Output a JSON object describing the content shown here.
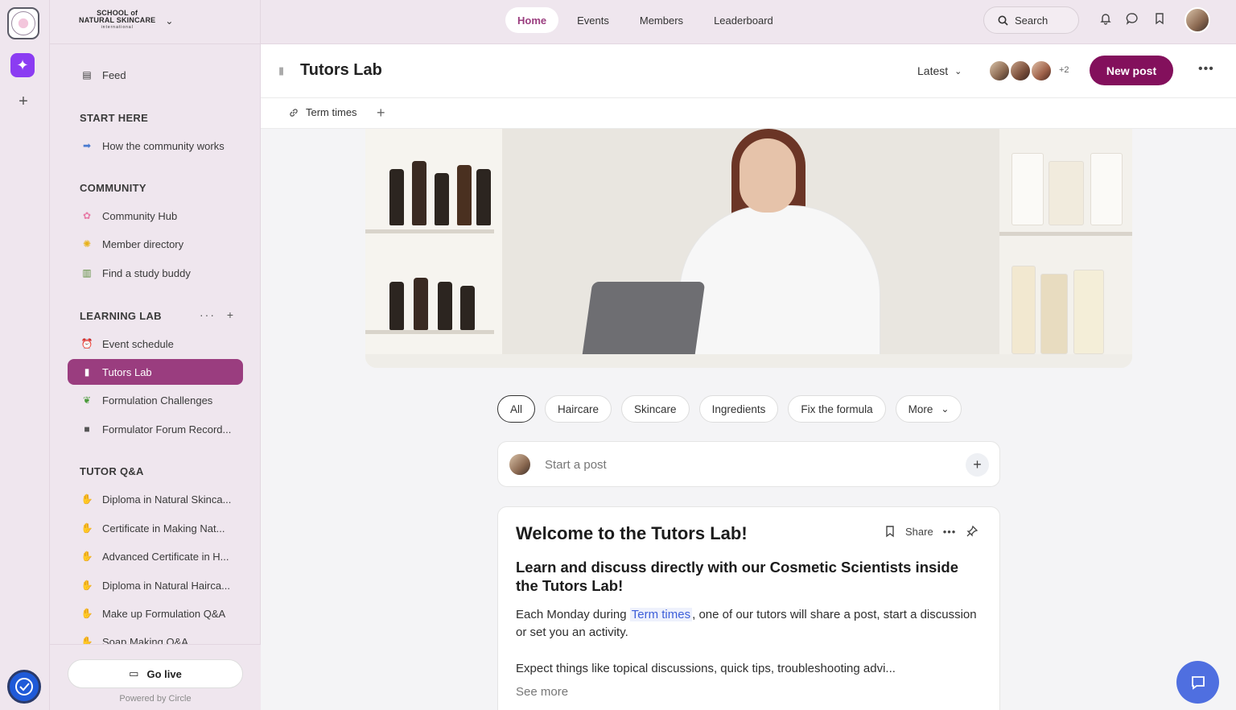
{
  "brand": {
    "name_line1": "SCHOOL of",
    "name_line2": "NATURAL SKINCARE",
    "name_line3": "international"
  },
  "topnav": {
    "tabs": [
      {
        "label": "Home",
        "active": true
      },
      {
        "label": "Events",
        "active": false
      },
      {
        "label": "Members",
        "active": false
      },
      {
        "label": "Leaderboard",
        "active": false
      }
    ],
    "search_label": "Search"
  },
  "sidebar": {
    "feed": {
      "label": "Feed",
      "icon": "feed-icon"
    },
    "sections": [
      {
        "title": "START HERE",
        "items": [
          {
            "label": "How the community works",
            "icon": "arrow-box-icon"
          }
        ]
      },
      {
        "title": "COMMUNITY",
        "items": [
          {
            "label": "Community Hub",
            "icon": "flower-icon"
          },
          {
            "label": "Member directory",
            "icon": "sunflower-icon"
          },
          {
            "label": "Find a study buddy",
            "icon": "books-icon"
          }
        ]
      },
      {
        "title": "LEARNING LAB",
        "items": [
          {
            "label": "Event schedule",
            "icon": "alarm-clock-icon"
          },
          {
            "label": "Tutors Lab",
            "icon": "lab-coat-icon",
            "active": true
          },
          {
            "label": "Formulation Challenges",
            "icon": "seedling-icon"
          },
          {
            "label": "Formulator Forum Record...",
            "icon": "video-camera-icon"
          }
        ]
      },
      {
        "title": "TUTOR Q&A",
        "items": [
          {
            "label": "Diploma in Natural Skinca...",
            "icon": "raised-hand-icon"
          },
          {
            "label": "Certificate in Making Nat...",
            "icon": "raised-hand-icon"
          },
          {
            "label": "Advanced Certificate in H...",
            "icon": "raised-hand-icon"
          },
          {
            "label": "Diploma in Natural Hairca...",
            "icon": "raised-hand-icon"
          },
          {
            "label": "Make up Formulation Q&A",
            "icon": "raised-hand-icon"
          },
          {
            "label": "Soap Making Q&A",
            "icon": "raised-hand-icon"
          }
        ]
      }
    ],
    "go_live_label": "Go live",
    "powered_by": "Powered by Circle"
  },
  "space": {
    "title": "Tutors Lab",
    "sort_label": "Latest",
    "member_extra": "+2",
    "new_post_label": "New post",
    "link_tab": "Term times"
  },
  "filters": [
    {
      "label": "All",
      "active": true
    },
    {
      "label": "Haircare",
      "active": false
    },
    {
      "label": "Skincare",
      "active": false
    },
    {
      "label": "Ingredients",
      "active": false
    },
    {
      "label": "Fix the formula",
      "active": false
    },
    {
      "label": "More",
      "active": false
    }
  ],
  "composer": {
    "placeholder": "Start a post"
  },
  "post": {
    "title": "Welcome to the Tutors Lab!",
    "share_label": "Share",
    "subtitle": "Learn and discuss directly with our Cosmetic Scientists inside the Tutors Lab!",
    "body_pre": "Each Monday during ",
    "body_link": "Term times",
    "body_post": ", one of our tutors will share a post, start a discussion or set you an activity.",
    "body2": "Expect things like topical discussions, quick tips, troubleshooting advi...",
    "see_more": "See more"
  },
  "colors": {
    "accent": "#9a3d7f",
    "primary_button": "#83105c",
    "sidebar_bg": "#efe6ee",
    "link": "#3e5fd9",
    "chat_bubble": "#4f6fe0"
  }
}
